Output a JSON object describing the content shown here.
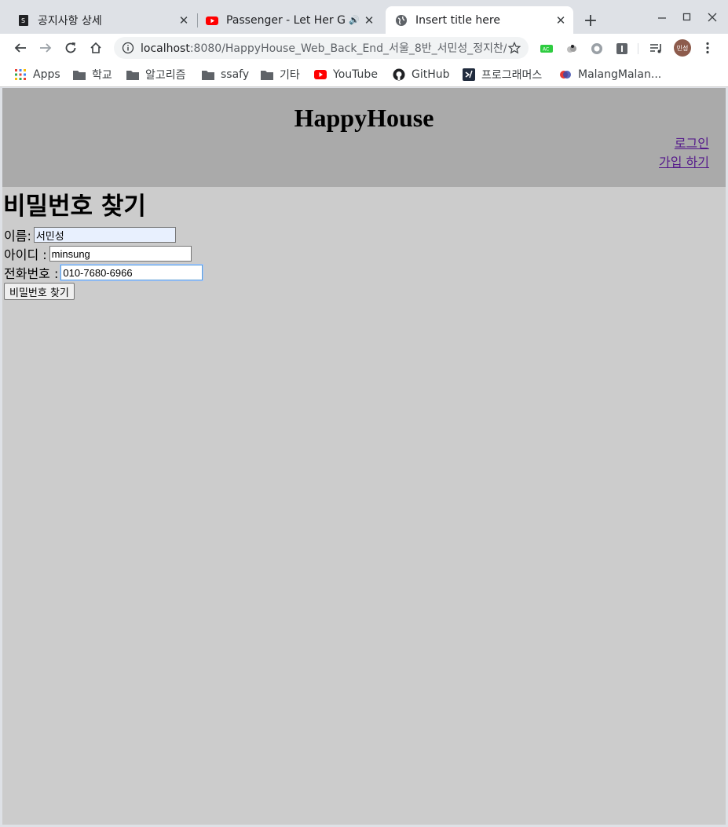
{
  "browser": {
    "tabs": [
      {
        "title": "공지사항 상세",
        "icon": "page-favicon-icon",
        "active": false
      },
      {
        "title": "Passenger - Let Her Go",
        "icon": "youtube-icon",
        "active": false,
        "audio": true
      },
      {
        "title": "Insert title here",
        "icon": "globe-icon",
        "active": true
      }
    ],
    "url_host": "localhost",
    "url_rest": ":8080/HappyHouse_Web_Back_End_서울_8반_서민성_정지찬/...",
    "profile_initials": "민성",
    "bookmarks": [
      {
        "label": "Apps",
        "icon": "apps-grid-icon"
      },
      {
        "label": "학교",
        "icon": "folder-icon"
      },
      {
        "label": "알고리즘",
        "icon": "folder-icon"
      },
      {
        "label": "ssafy",
        "icon": "folder-icon"
      },
      {
        "label": "기타",
        "icon": "folder-icon"
      },
      {
        "label": "YouTube",
        "icon": "youtube-icon"
      },
      {
        "label": "GitHub",
        "icon": "github-icon"
      },
      {
        "label": "프로그래머스",
        "icon": "programmers-icon"
      },
      {
        "label": "MalangMalan...",
        "icon": "malang-icon"
      }
    ]
  },
  "page": {
    "site_title": "HappyHouse",
    "nav": {
      "login": "로그인",
      "signup": "가입 하기"
    },
    "heading": "비밀번호 찾기",
    "form": {
      "name_label": "이름:",
      "name_value": "서민성",
      "id_label": "아이디 :",
      "id_value": "minsung",
      "phone_label": "전화번호 :",
      "phone_value": "010-7680-6966",
      "submit_label": "비밀번호 찾기"
    }
  },
  "colors": {
    "header_bg": "#aaaaaa",
    "body_bg": "#cccccc",
    "link_visited": "#551a8b"
  }
}
